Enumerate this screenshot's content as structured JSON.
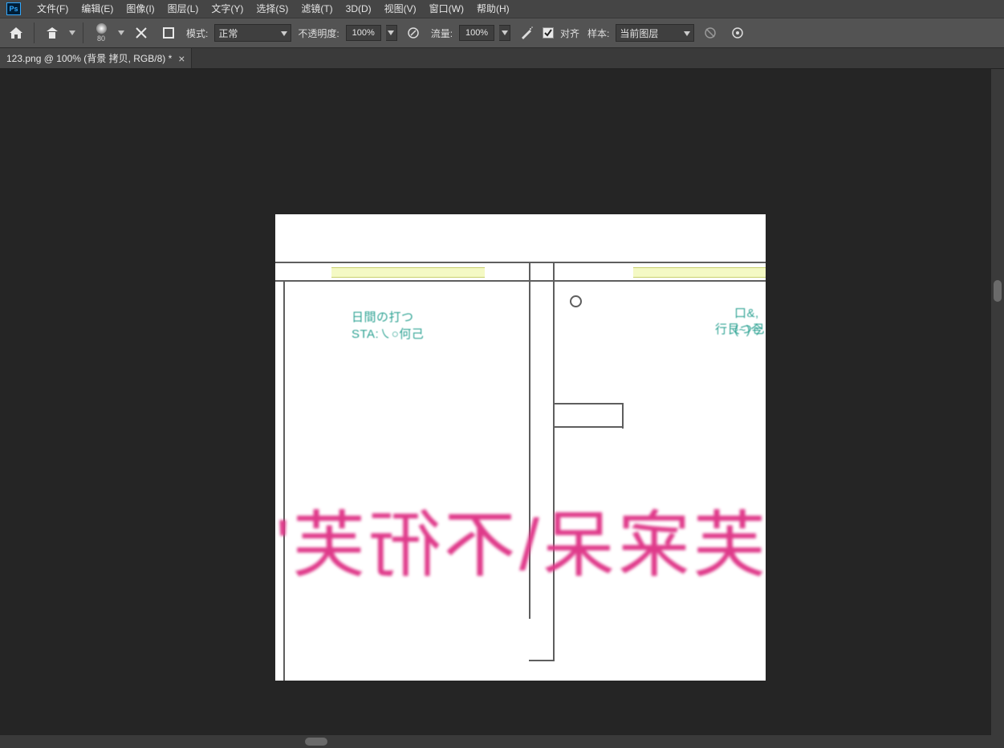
{
  "menubar": {
    "items": [
      "文件(F)",
      "编辑(E)",
      "图像(I)",
      "图层(L)",
      "文字(Y)",
      "选择(S)",
      "滤镜(T)",
      "3D(D)",
      "视图(V)",
      "窗口(W)",
      "帮助(H)"
    ]
  },
  "options": {
    "brush_size": "80",
    "mode_label": "模式:",
    "mode_value": "正常",
    "opacity_label": "不透明度:",
    "opacity_value": "100%",
    "flow_label": "流量:",
    "flow_value": "100%",
    "align_label": "对齐",
    "align_checked": true,
    "sample_label": "样本:",
    "sample_value": "当前图层"
  },
  "tab": {
    "title": "123.png @ 100% (背景 拷贝, RGB/8) *"
  },
  "canvas": {
    "labels": {
      "left_top": "日間の打つ",
      "left_bottom": "STA:㇏○何己",
      "right_top": "口&,(~)今",
      "right_bottom": "行艮つ己"
    },
    "overlay_text": "芙宷呆\\不衎芙'"
  }
}
